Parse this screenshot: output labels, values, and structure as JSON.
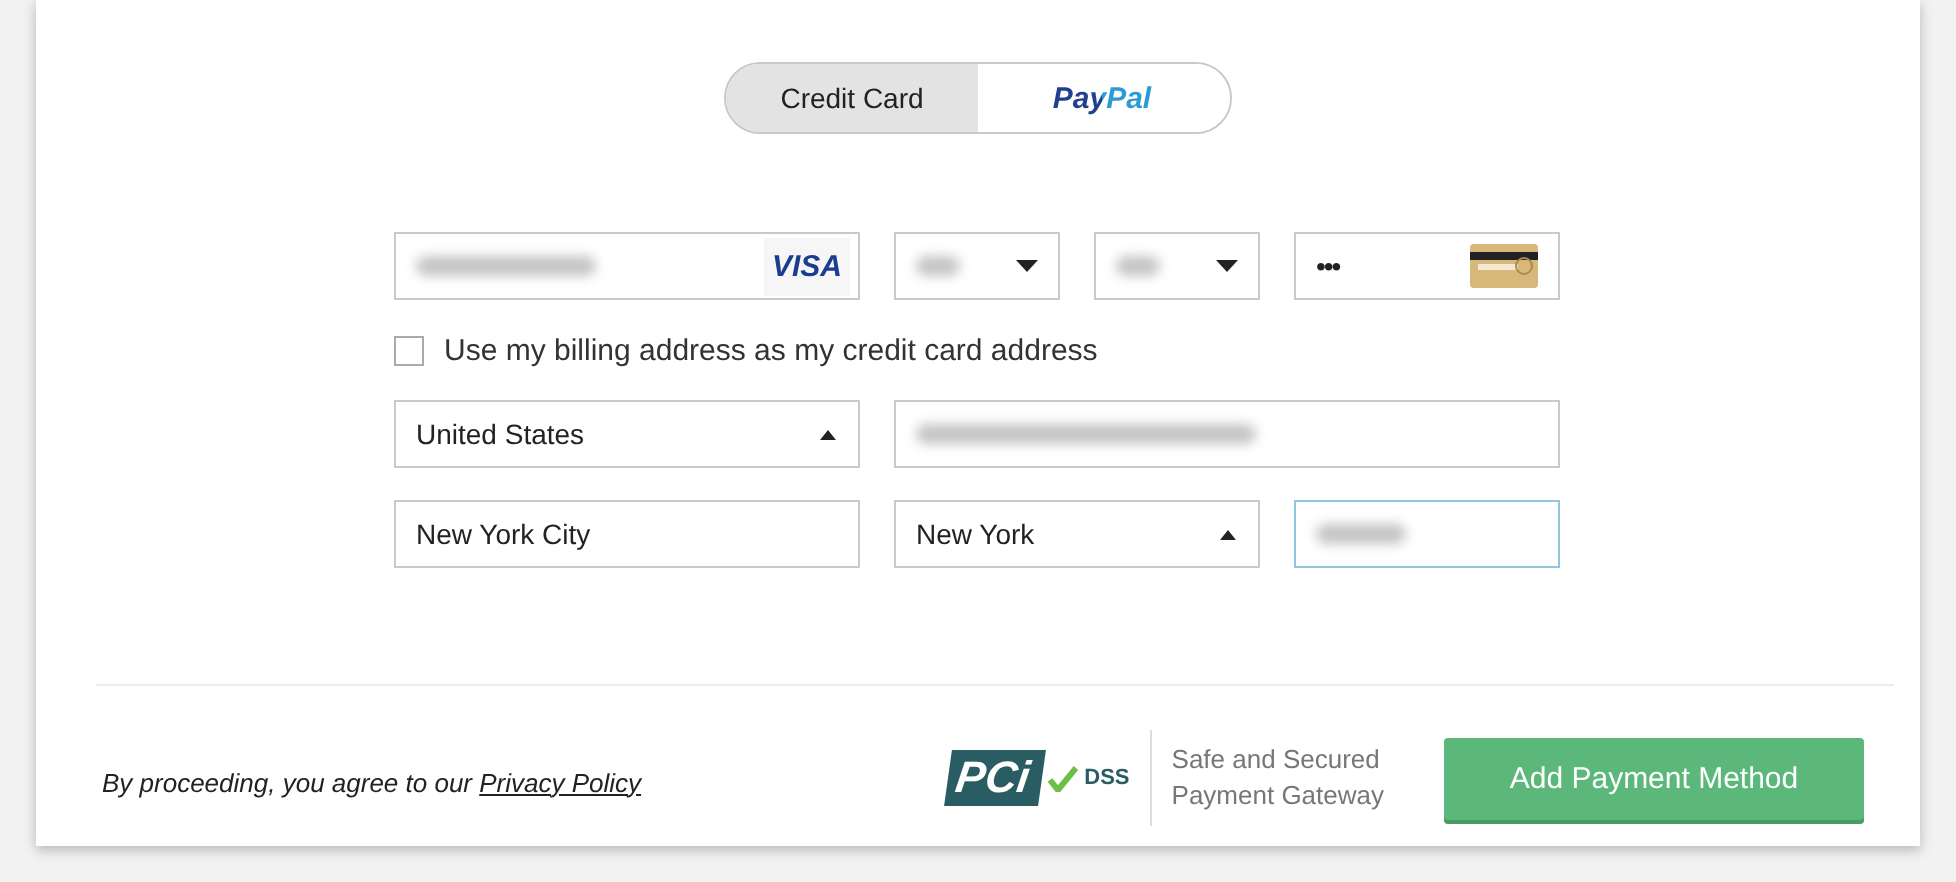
{
  "payment_tabs": [
    {
      "label": "Credit Card",
      "kind": "text",
      "selected": true
    },
    {
      "label": "PayPal",
      "kind": "brand",
      "selected": false
    }
  ],
  "card_row": [
    {
      "kind": "card-number",
      "blurred": true,
      "brand": "VISA"
    },
    {
      "kind": "select",
      "blurred": true,
      "expanded": false
    },
    {
      "kind": "select",
      "blurred": true,
      "expanded": false
    },
    {
      "kind": "cvv",
      "value": "•••"
    }
  ],
  "billing_checkbox": {
    "label": "Use my billing address as my credit card address",
    "checked": false
  },
  "address_rows": [
    [
      {
        "kind": "select",
        "value": "United States",
        "expanded": true
      },
      {
        "kind": "text",
        "blurred": true
      }
    ],
    [
      {
        "kind": "text",
        "value": "New York City"
      },
      {
        "kind": "select",
        "value": "New York",
        "expanded": true
      },
      {
        "kind": "text",
        "blurred": true,
        "focused": true
      }
    ]
  ],
  "footer": {
    "consent": "By proceeding, you agree to our ",
    "link": "Privacy Policy",
    "pci_logo": {
      "letters": "PCi",
      "badge": "DSS"
    },
    "security_note": [
      "Safe and Secured",
      "Payment Gateway"
    ],
    "submit": "Add Payment Method"
  }
}
